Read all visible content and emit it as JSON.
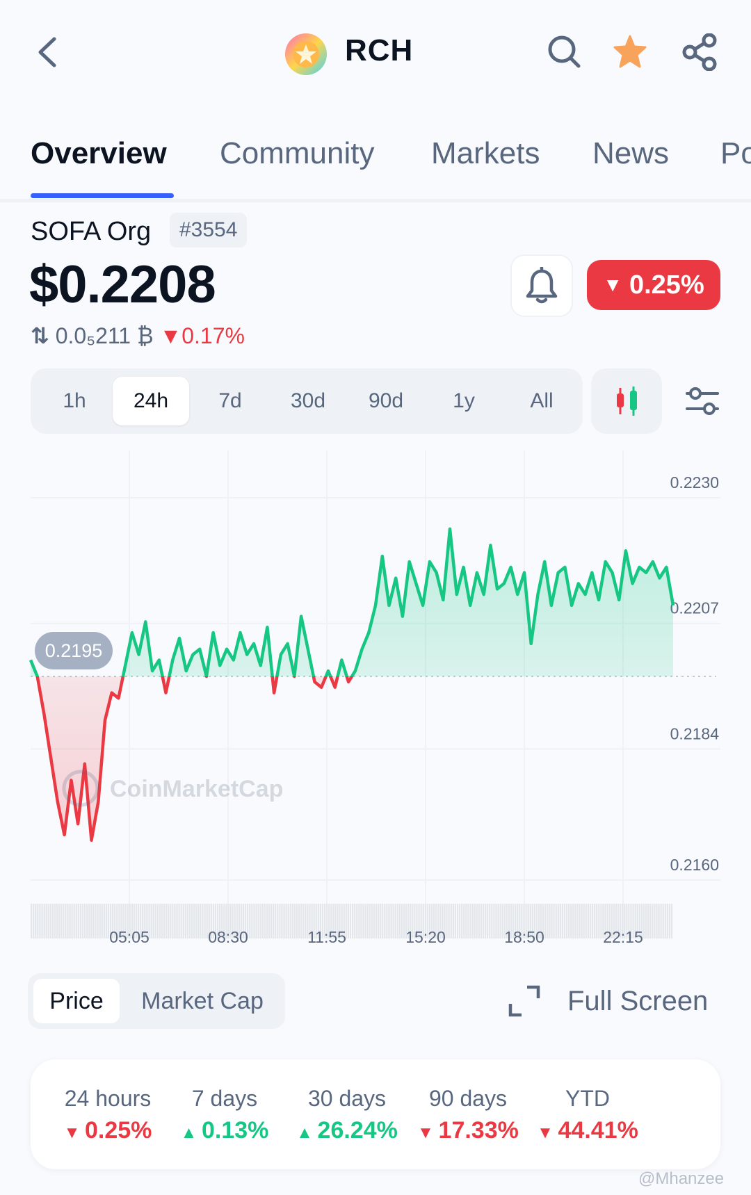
{
  "header": {
    "symbol": "RCH",
    "icons": [
      "back-icon",
      "search-icon",
      "star-icon",
      "share-icon"
    ],
    "star_color": "#f7a35c"
  },
  "tabs": [
    "Overview",
    "Community",
    "Markets",
    "News",
    "Po"
  ],
  "coin": {
    "name": "SOFA Org",
    "rank": "#3554",
    "price": "$0.2208",
    "btc_price": "0.0₅211 ₿",
    "btc_change": "0.17%",
    "change_24h": "0.25%"
  },
  "ranges": [
    "1h",
    "24h",
    "7d",
    "30d",
    "90d",
    "1y",
    "All"
  ],
  "selected_range": "24h",
  "chart_data": {
    "type": "line",
    "x_ticks": [
      "05:05",
      "08:30",
      "11:55",
      "15:20",
      "18:50",
      "22:15"
    ],
    "y_ticks": [
      "0.2230",
      "0.2207",
      "0.2184",
      "0.2160"
    ],
    "open_label": "0.2195",
    "watermark": "CoinMarketCap",
    "ylim": [
      0.216,
      0.223
    ],
    "baseline": 0.2195,
    "colors": {
      "up": "#16c784",
      "down": "#ea3943"
    },
    "values": [
      0.2198,
      0.2195,
      0.2188,
      0.218,
      0.2172,
      0.2166,
      0.2176,
      0.2168,
      0.2179,
      0.2165,
      0.2172,
      0.2187,
      0.2192,
      0.2191,
      0.2197,
      0.2203,
      0.2199,
      0.2205,
      0.2196,
      0.2198,
      0.2192,
      0.2198,
      0.2202,
      0.2196,
      0.2199,
      0.22,
      0.2195,
      0.2203,
      0.2197,
      0.22,
      0.2198,
      0.2203,
      0.2199,
      0.2201,
      0.2197,
      0.2204,
      0.2192,
      0.2199,
      0.2201,
      0.2195,
      0.2206,
      0.22,
      0.2194,
      0.2193,
      0.2196,
      0.2193,
      0.2198,
      0.2194,
      0.2196,
      0.22,
      0.2203,
      0.2208,
      0.2217,
      0.2208,
      0.2213,
      0.2206,
      0.2216,
      0.2212,
      0.2208,
      0.2216,
      0.2214,
      0.2209,
      0.2222,
      0.221,
      0.2215,
      0.2208,
      0.2214,
      0.221,
      0.2219,
      0.2211,
      0.2212,
      0.2215,
      0.221,
      0.2214,
      0.2201,
      0.221,
      0.2216,
      0.2208,
      0.2214,
      0.2215,
      0.2208,
      0.2212,
      0.221,
      0.2214,
      0.2209,
      0.2216,
      0.2214,
      0.2209,
      0.2218,
      0.2212,
      0.2215,
      0.2214,
      0.2216,
      0.2213,
      0.2215,
      0.2208
    ]
  },
  "chart_toggle": [
    "Price",
    "Market Cap"
  ],
  "fullscreen_label": "Full Screen",
  "performance": [
    {
      "label": "24 hours",
      "value": "0.25%",
      "dir": "down"
    },
    {
      "label": "7 days",
      "value": "0.13%",
      "dir": "up"
    },
    {
      "label": "30 days",
      "value": "26.24%",
      "dir": "up"
    },
    {
      "label": "90 days",
      "value": "17.33%",
      "dir": "down"
    },
    {
      "label": "YTD",
      "value": "44.41%",
      "dir": "down"
    }
  ],
  "credit": "@Mhanzee"
}
